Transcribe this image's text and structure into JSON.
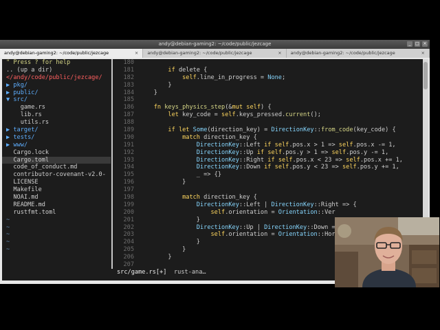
{
  "window": {
    "title": "andy@debian-gaming2: ~/code/public/jezcage",
    "controls": [
      "_",
      "□",
      "×"
    ]
  },
  "tabs": [
    {
      "label": "andy@debian-gaming2: ~/code/public/jezcage",
      "close": "×"
    },
    {
      "label": "andy@debian-gaming2: ~/code/public/jezcage",
      "close": "×"
    },
    {
      "label": "andy@debian-gaming2: ~/code/public/jezcage",
      "close": "×"
    }
  ],
  "tree": {
    "help": "\" Press ? for help",
    "up": ".. (up a dir)",
    "root": "</andy/code/public/jezcage/",
    "items": [
      {
        "arrow": "▶",
        "name": "pkg/"
      },
      {
        "arrow": "▶",
        "name": "public/"
      },
      {
        "arrow": "▼",
        "name": "src/"
      },
      {
        "arrow": "",
        "name": "    game.rs"
      },
      {
        "arrow": "",
        "name": "    lib.rs"
      },
      {
        "arrow": "",
        "name": "    utils.rs"
      },
      {
        "arrow": "▶",
        "name": "target/"
      },
      {
        "arrow": "▶",
        "name": "tests/"
      },
      {
        "arrow": "▶",
        "name": "www/"
      },
      {
        "arrow": "",
        "name": "  Cargo.lock"
      },
      {
        "arrow": "",
        "name": "  Cargo.toml"
      },
      {
        "arrow": "",
        "name": "  code_of_conduct.md"
      },
      {
        "arrow": "",
        "name": "  contributor-covenant-v2.0-"
      },
      {
        "arrow": "",
        "name": "  LICENSE"
      },
      {
        "arrow": "",
        "name": "  Makefile"
      },
      {
        "arrow": "",
        "name": "  NOAI.md"
      },
      {
        "arrow": "",
        "name": "  README.md"
      },
      {
        "arrow": "",
        "name": "  rustfmt.toml"
      }
    ],
    "tilde": "~"
  },
  "code": {
    "lines": [
      {
        "n": "180",
        "t": ""
      },
      {
        "n": "181",
        "t": "        if delete {"
      },
      {
        "n": "182",
        "t": "            self.line_in_progress = None;"
      },
      {
        "n": "183",
        "t": "        }"
      },
      {
        "n": "184",
        "t": "    }"
      },
      {
        "n": "185",
        "t": ""
      },
      {
        "n": "186",
        "t": "    fn keys_physics_step(&mut self) {"
      },
      {
        "n": "187",
        "t": "        let key_code = self.keys_pressed.current();"
      },
      {
        "n": "188",
        "t": ""
      },
      {
        "n": "189",
        "t": "        if let Some(direction_key) = DirectionKey::from_code(key_code) {"
      },
      {
        "n": "190",
        "t": "            match direction_key {"
      },
      {
        "n": "191",
        "t": "                DirectionKey::Left if self.pos.x > 1 => self.pos.x -= 1,"
      },
      {
        "n": "192",
        "t": "                DirectionKey::Up if self.pos.y > 1 => self.pos.y -= 1,"
      },
      {
        "n": "193",
        "t": "                DirectionKey::Right if self.pos.x < 23 => self.pos.x += 1,"
      },
      {
        "n": "194",
        "t": "                DirectionKey::Down if self.pos.y < 23 => self.pos.y += 1,"
      },
      {
        "n": "195",
        "t": "                _ => {}"
      },
      {
        "n": "196",
        "t": "            }"
      },
      {
        "n": "197",
        "t": ""
      },
      {
        "n": "198",
        "t": "            match direction_key {"
      },
      {
        "n": "199",
        "t": "                DirectionKey::Left | DirectionKey::Right => {"
      },
      {
        "n": "200",
        "t": "                    self.orientation = Orientation::Ver"
      },
      {
        "n": "201",
        "t": "                }"
      },
      {
        "n": "202",
        "t": "                DirectionKey::Up | DirectionKey::Down =>"
      },
      {
        "n": "203",
        "t": "                    self.orientation = Orientation::Hor"
      },
      {
        "n": "204",
        "t": "                }"
      },
      {
        "n": "205",
        "t": "            }"
      },
      {
        "n": "206",
        "t": "        }"
      },
      {
        "n": "207",
        "t": ""
      }
    ]
  },
  "statusline": {
    "file": "src/game.rs[+]",
    "lsp": "rust-ana…"
  },
  "colors": {
    "keyword": "#ffd75f",
    "type": "#87d7ff",
    "function": "#d7d787",
    "linenumber": "#6c6c6c",
    "directory": "#5fafff"
  }
}
